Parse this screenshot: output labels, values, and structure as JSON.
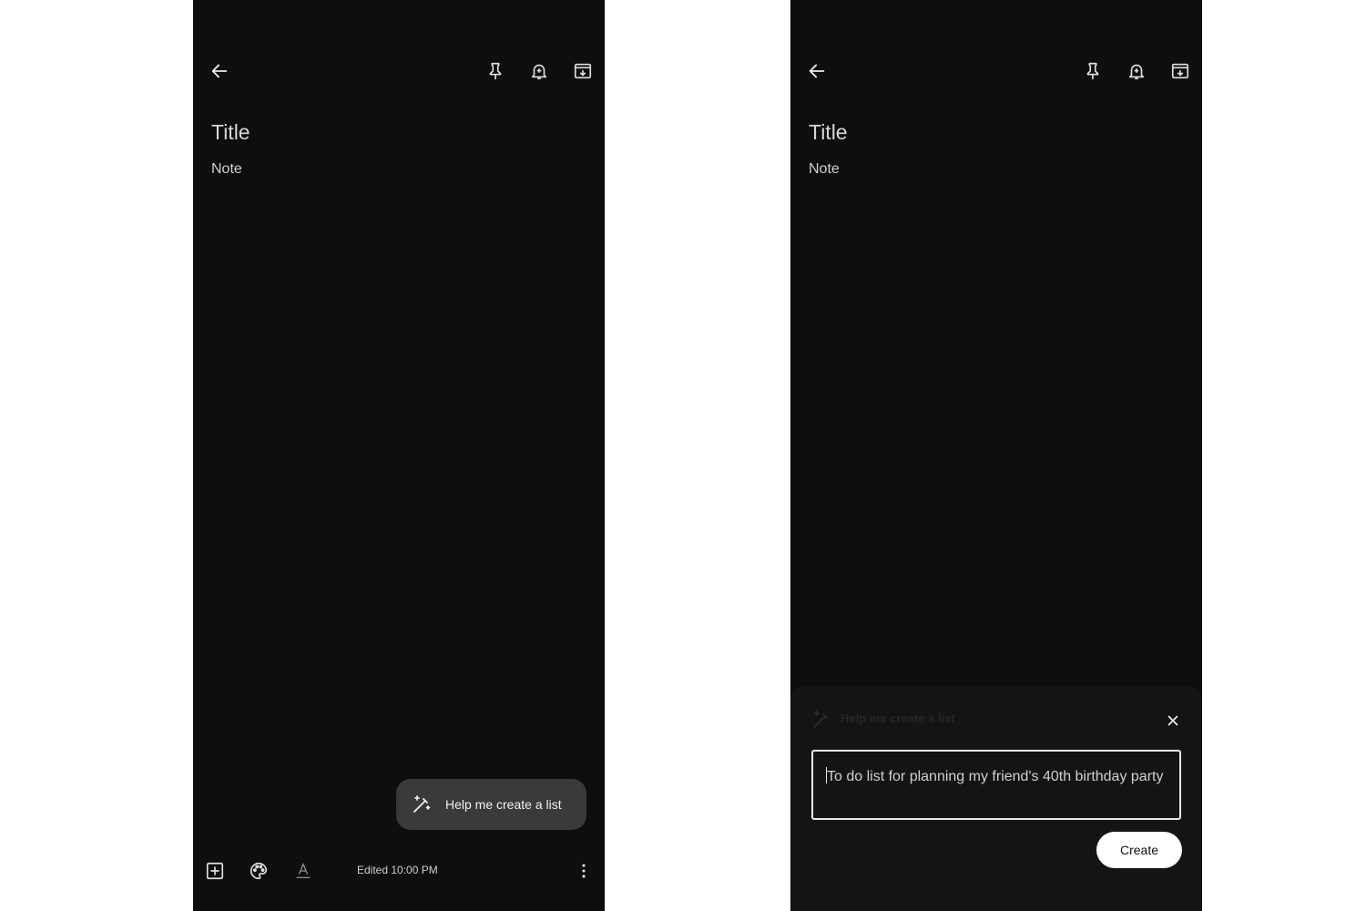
{
  "left_screen": {
    "title_placeholder": "Title",
    "note_placeholder": "Note",
    "help_button_label": "Help me create a list",
    "edited_text": "Edited 10:00 PM",
    "icons": {
      "back": "back-arrow-icon",
      "pin": "pin-icon",
      "reminder": "reminder-bell-icon",
      "archive": "archive-icon",
      "add_box": "add-box-icon",
      "palette": "palette-icon",
      "text_format": "text-format-icon",
      "more": "more-vert-icon",
      "magic": "magic-wand-icon"
    }
  },
  "right_screen": {
    "title_placeholder": "Title",
    "note_placeholder": "Note",
    "sheet_title": "Help me create a list",
    "prompt_text": "To do list for planning my friend's 40th birthday party",
    "create_button_label": "Create",
    "icons": {
      "back": "back-arrow-icon",
      "pin": "pin-icon",
      "reminder": "reminder-bell-icon",
      "archive": "archive-icon",
      "close": "close-icon",
      "magic": "magic-wand-icon"
    }
  },
  "colors": {
    "screen_background": "#0e0e10",
    "fab_background": "#3a3a3c",
    "sheet_background": "#141416",
    "create_button": "#ffffff"
  }
}
